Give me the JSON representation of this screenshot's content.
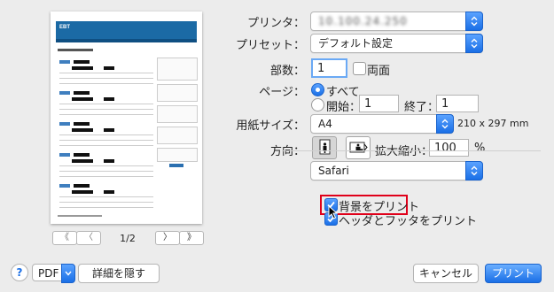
{
  "preview": {
    "header_logo": "EBT",
    "page_indicator": "1/2",
    "nav_first": "《",
    "nav_prev": "〈",
    "nav_next": "〉",
    "nav_last": "》"
  },
  "printer": {
    "label": "プリンタ：",
    "value": "10.100.24.250"
  },
  "preset": {
    "label": "プリセット：",
    "value": "デフォルト設定"
  },
  "copies": {
    "label": "部数：",
    "value": "1",
    "duplex_label": "両面",
    "duplex_checked": false
  },
  "pages": {
    "label": "ページ：",
    "all_label": "すべて",
    "from_label": "開始：",
    "from_value": "1",
    "to_label": "終了：",
    "to_value": "1",
    "selected": "all"
  },
  "paper_size": {
    "label": "用紙サイズ：",
    "value": "A4",
    "dimensions": "210 x 297 mm"
  },
  "orientation": {
    "label": "方向：",
    "scale_label": "拡大縮小：",
    "scale_value": "100",
    "scale_unit": "%"
  },
  "app_section": {
    "value": "Safari"
  },
  "options": {
    "print_backgrounds_label": "背景をプリント",
    "print_backgrounds_checked": true,
    "headers_footers_label": "ヘッダとフッタをプリント",
    "headers_footers_checked": true
  },
  "footer": {
    "help_label": "?",
    "pdf_label": "PDF",
    "hide_details_label": "詳細を隠す",
    "cancel_label": "キャンセル",
    "print_label": "プリント"
  },
  "colors": {
    "accent": "#1a6fe6",
    "highlight": "#e0001a",
    "preview_header": "#1b6aa5"
  }
}
